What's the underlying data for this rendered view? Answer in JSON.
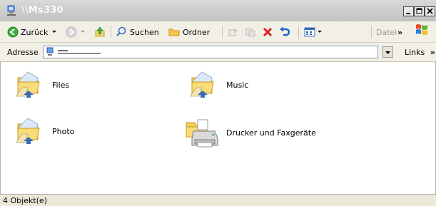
{
  "window": {
    "title": "\\\\Ms330",
    "buttons": {
      "minimize": "_",
      "maximize": "□",
      "close": "×"
    }
  },
  "toolbar": {
    "back_label": "Zurück",
    "search_label": "Suchen",
    "folders_label": "Ordner",
    "file_label": "Datei",
    "overflow": "»"
  },
  "addressbar": {
    "label": "Adresse",
    "links_label": "Links",
    "overflow": "»"
  },
  "items": [
    {
      "name": "Files",
      "icon": "shared-folder-icon"
    },
    {
      "name": "Music",
      "icon": "shared-folder-icon"
    },
    {
      "name": "Photo",
      "icon": "shared-folder-icon"
    },
    {
      "name": "Drucker und Faxgeräte",
      "icon": "printers-faxes-icon"
    }
  ],
  "status": {
    "text": "4 Objekt(e)"
  },
  "colors": {
    "title_bar": "#cfcfcf",
    "toolbar_bg": "#f2f0e6",
    "content_bg": "#ffffff",
    "delete_red": "#e02020",
    "undo_blue": "#1f5fd1"
  }
}
